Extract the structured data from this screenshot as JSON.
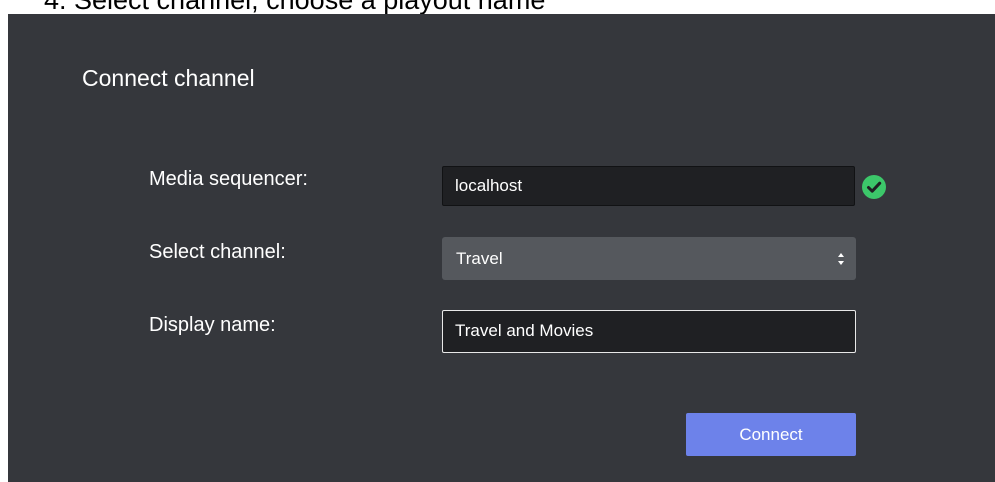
{
  "top_caption": "4. Select channel, choose a playout name",
  "dialog": {
    "title": "Connect channel",
    "fields": {
      "media_sequencer": {
        "label": "Media sequencer:",
        "value": "localhost",
        "status_icon": "check-circle-icon",
        "status_color": "#3cc76a"
      },
      "channel": {
        "label": "Select channel:",
        "selected": "Travel",
        "icon": "select-arrows-icon"
      },
      "display_name": {
        "label": "Display name:",
        "value": "Travel and Movies"
      }
    },
    "connect_label": "Connect"
  },
  "colors": {
    "dialog_background": "#35373c",
    "input_background": "#1f2023",
    "select_background": "#55585d",
    "button_background": "#6d82ea",
    "text": "#ffffff"
  }
}
